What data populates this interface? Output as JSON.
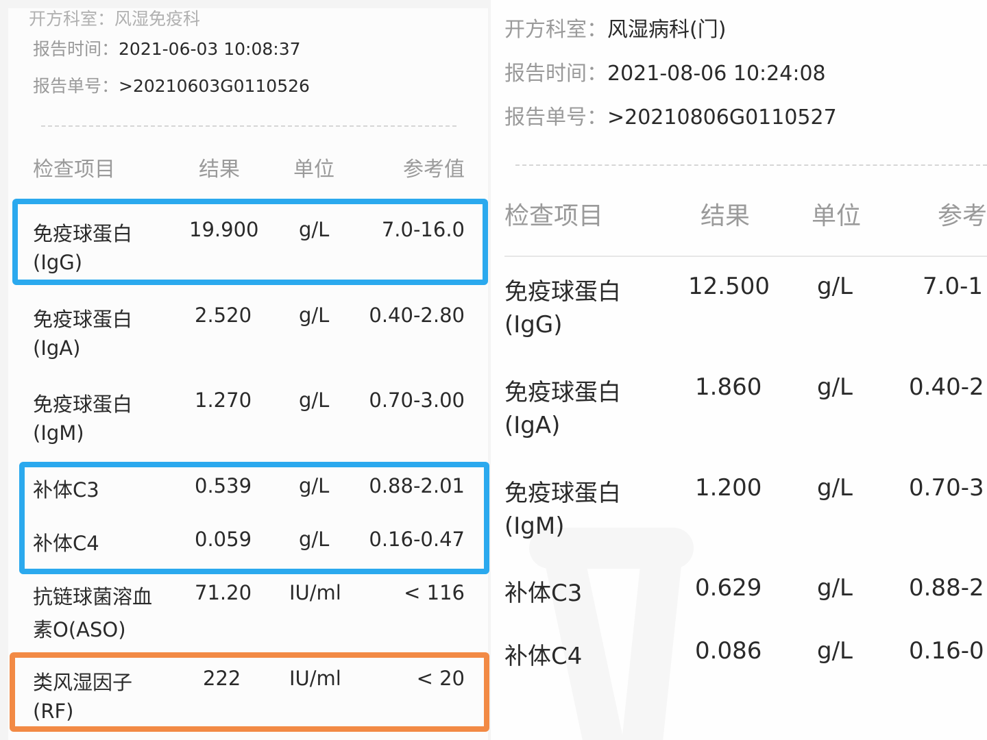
{
  "left": {
    "meta": {
      "dept_label": "开方科室：",
      "dept_value": "风湿免疫科",
      "time_label": "报告时间：",
      "time_value": "2021-06-03 10:08:37",
      "id_label": "报告单号：",
      "id_value": ">20210603G0110526"
    },
    "headers": {
      "item": "检查项目",
      "result": "结果",
      "unit": "单位",
      "ref": "参考值"
    },
    "rows": [
      {
        "name1": "免疫球蛋白",
        "name2": "(IgG)",
        "result": "19.900",
        "unit": "g/L",
        "ref": "7.0-16.0"
      },
      {
        "name1": "免疫球蛋白",
        "name2": "(IgA)",
        "result": "2.520",
        "unit": "g/L",
        "ref": "0.40-2.80"
      },
      {
        "name1": "免疫球蛋白",
        "name2": "(IgM)",
        "result": "1.270",
        "unit": "g/L",
        "ref": "0.70-3.00"
      },
      {
        "name1": "补体C3",
        "name2": "",
        "result": "0.539",
        "unit": "g/L",
        "ref": "0.88-2.01"
      },
      {
        "name1": "补体C4",
        "name2": "",
        "result": "0.059",
        "unit": "g/L",
        "ref": "0.16-0.47"
      },
      {
        "name1": "抗链球菌溶血",
        "name2": "素O(ASO)",
        "result": "71.20",
        "unit": "IU/ml",
        "ref": "< 116"
      },
      {
        "name1": "类风湿因子",
        "name2": "(RF)",
        "result": "222",
        "unit": "IU/ml",
        "ref": "< 20"
      }
    ],
    "highlights": {
      "blue": "#2ba9ee",
      "orange": "#f28a45"
    }
  },
  "right": {
    "meta": {
      "dept_label": "开方科室：",
      "dept_value": "风湿病科(门)",
      "time_label": "报告时间：",
      "time_value": "2021-08-06 10:24:08",
      "id_label": "报告单号：",
      "id_value": ">20210806G0110527"
    },
    "headers": {
      "item": "检查项目",
      "result": "结果",
      "unit": "单位",
      "ref": "参考"
    },
    "rows": [
      {
        "name1": "免疫球蛋白",
        "name2": "(IgG)",
        "result": "12.500",
        "unit": "g/L",
        "ref": "7.0-1"
      },
      {
        "name1": "免疫球蛋白",
        "name2": "(IgA)",
        "result": "1.860",
        "unit": "g/L",
        "ref": "0.40-2"
      },
      {
        "name1": "免疫球蛋白",
        "name2": "(IgM)",
        "result": "1.200",
        "unit": "g/L",
        "ref": "0.70-3"
      },
      {
        "name1": "补体C3",
        "name2": "",
        "result": "0.629",
        "unit": "g/L",
        "ref": "0.88-2"
      },
      {
        "name1": "补体C4",
        "name2": "",
        "result": "0.086",
        "unit": "g/L",
        "ref": "0.16-0"
      }
    ]
  }
}
